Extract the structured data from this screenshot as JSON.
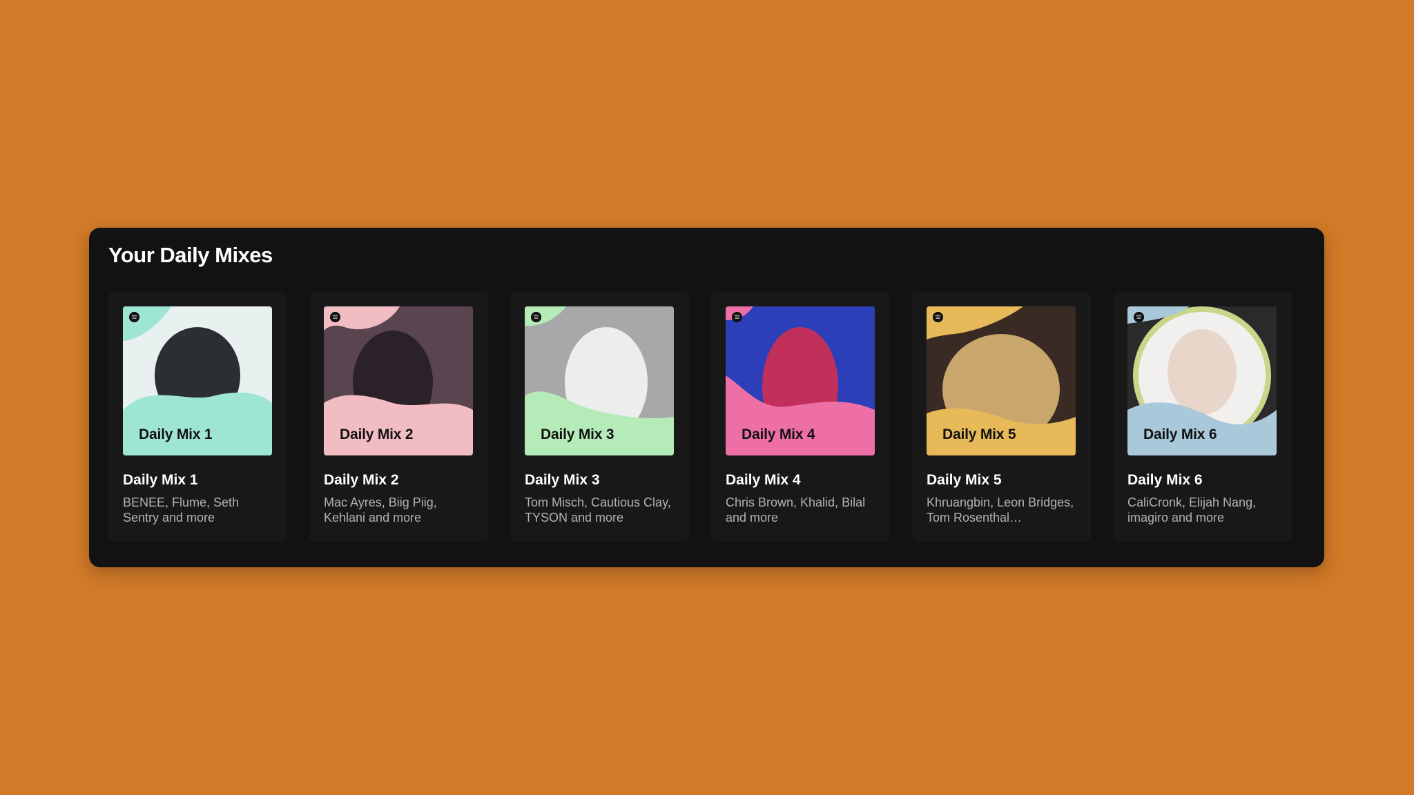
{
  "section": {
    "title": "Your Daily Mixes"
  },
  "cards": [
    {
      "cover_label": "Daily Mix 1",
      "title": "Daily Mix 1",
      "description": "BENEE, Flume, Seth Sentry and more",
      "accent": "#9EE6D3",
      "bg": "#E8F1F0",
      "subject": "#2B2E33"
    },
    {
      "cover_label": "Daily Mix 2",
      "title": "Daily Mix 2",
      "description": "Mac Ayres, Biig Piig, Kehlani and more",
      "accent": "#F2BCC3",
      "bg": "#5A4450",
      "subject": "#2A2228"
    },
    {
      "cover_label": "Daily Mix 3",
      "title": "Daily Mix 3",
      "description": "Tom Misch, Cautious Clay, TYSON and more",
      "accent": "#B5EBB8",
      "bg": "#A8A8A8",
      "subject": "#EDEDED"
    },
    {
      "cover_label": "Daily Mix 4",
      "title": "Daily Mix 4",
      "description": "Chris Brown, Khalid, Bilal and more",
      "accent": "#EE6FA5",
      "bg": "#2D3FB8",
      "subject": "#C0305A"
    },
    {
      "cover_label": "Daily Mix 5",
      "title": "Daily Mix 5",
      "description": "Khruangbin, Leon Bridges, Tom Rosenthal…",
      "accent": "#E8B959",
      "bg": "#3A2A24",
      "subject": "#C9A66B"
    },
    {
      "cover_label": "Daily Mix 6",
      "title": "Daily Mix 6",
      "description": "CaliCronk, Elijah Nang, imagiro and more",
      "accent": "#A9C9DB",
      "bg": "#2A2A2A",
      "subject": "#E7D6C9"
    }
  ],
  "icons": {
    "cover_logo": "spotify-icon"
  }
}
